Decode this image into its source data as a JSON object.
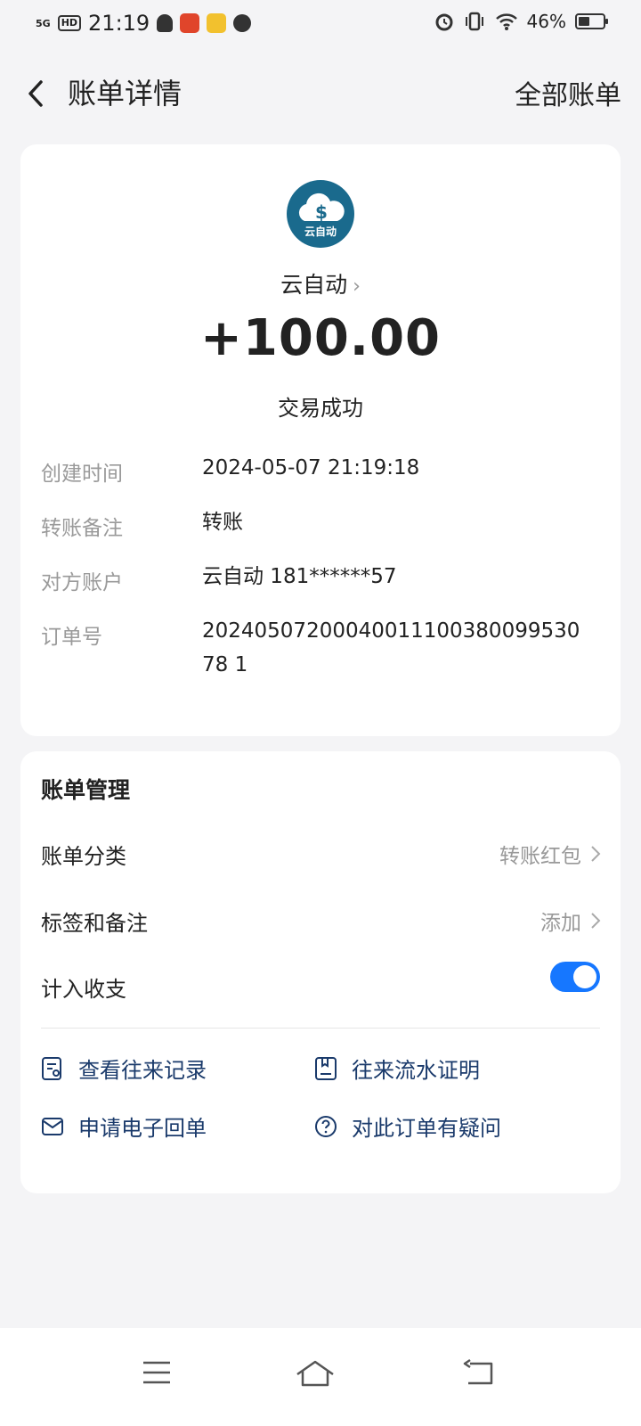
{
  "status_bar": {
    "signal": "5G",
    "hd": "HD",
    "time": "21:19",
    "battery": "46%"
  },
  "header": {
    "title": "账单详情",
    "right_link": "全部账单"
  },
  "transaction": {
    "logo_text": "云自动",
    "merchant": "云自动",
    "amount": "+100.00",
    "status": "交易成功",
    "details": [
      {
        "label": "创建时间",
        "value": "2024-05-07 21:19:18"
      },
      {
        "label": "转账备注",
        "value": "转账"
      },
      {
        "label": "对方账户",
        "value": "云自动 181******57"
      },
      {
        "label": "订单号",
        "value": "2024050720004001110038009953078 1"
      }
    ]
  },
  "management": {
    "title": "账单管理",
    "category_label": "账单分类",
    "category_value": "转账红包",
    "tags_label": "标签和备注",
    "tags_value": "添加",
    "count_label": "计入收支",
    "count_enabled": true,
    "links": {
      "records": "查看往来记录",
      "proof": "往来流水证明",
      "receipt": "申请电子回单",
      "question": "对此订单有疑问"
    }
  },
  "colors": {
    "accent": "#1677ff",
    "logo_bg": "#1a6a8d",
    "link_text": "#1a3a6b"
  }
}
